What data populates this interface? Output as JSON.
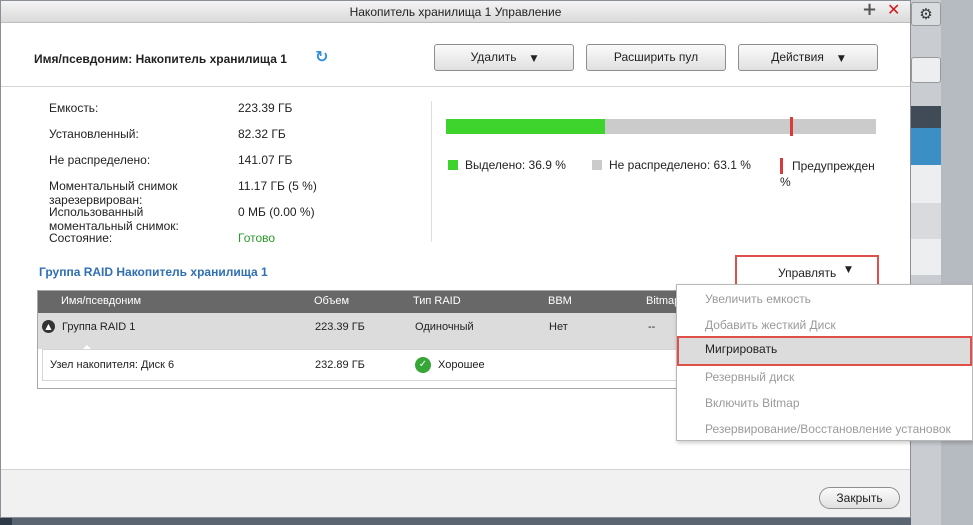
{
  "window": {
    "title": "Накопитель хранилища 1 Управление",
    "plus_icon": "+",
    "close_icon": "✕"
  },
  "header": {
    "name": "Имя/псевдоним: Накопитель хранилища 1",
    "refresh_icon": "↻",
    "buttons": {
      "delete": "Удалить",
      "expand_pool": "Расширить пул",
      "actions": "Действия"
    },
    "caret": "▼"
  },
  "info": [
    {
      "label": "Емкость:",
      "value": "223.39 ГБ"
    },
    {
      "label": "Установленный:",
      "value": "82.32 ГБ"
    },
    {
      "label": "Не распределено:",
      "value": "141.07 ГБ"
    },
    {
      "label": "Моментальный снимок зарезервирован:",
      "value": "11.17 ГБ (5 %)"
    },
    {
      "label": "Использованный моментальный снимок:",
      "value": "0 МБ (0.00 %)"
    },
    {
      "label": "Состояние:",
      "value": "Готово"
    }
  ],
  "usage": {
    "allocated_pct": 36.9,
    "warning_pct": 80,
    "legend_allocated": "Выделено: 36.9 %",
    "legend_unallocated": "Не распределено: 63.1 %",
    "legend_warning": "Предупрежден",
    "legend_warning_suffix": "%",
    "colors": {
      "allocated": "#3ed32d",
      "unallocated": "#cbcbcb",
      "warning": "#d93b3b"
    }
  },
  "raid": {
    "title": "Группа RAID Накопитель хранилища 1",
    "manage_label": "Управлять",
    "columns": [
      "Имя/псевдоним",
      "Объем",
      "Тип RAID",
      "BBM",
      "Bitmap"
    ],
    "group_row": {
      "name": "Группа RAID 1",
      "size": "223.39 ГБ",
      "type": "Одиночный",
      "bbm": "Нет",
      "bitmap": "--"
    },
    "disk_row": {
      "name": "Узел накопителя: Диск 6",
      "size": "232.89 ГБ",
      "status": "Хорошее"
    }
  },
  "manage_menu": [
    {
      "label": "Увеличить емкость",
      "enabled": false
    },
    {
      "label": "Добавить жесткий Диск",
      "enabled": false
    },
    {
      "label": "Мигрировать",
      "enabled": true
    },
    {
      "label": "Резервный диск",
      "enabled": false
    },
    {
      "label": "Включить Bitmap",
      "enabled": false
    },
    {
      "label": "Резервирование/Восстановление установок",
      "enabled": false
    }
  ],
  "footer": {
    "close_label": "Закрыть"
  },
  "background": {
    "gear_icon": "⚙"
  }
}
